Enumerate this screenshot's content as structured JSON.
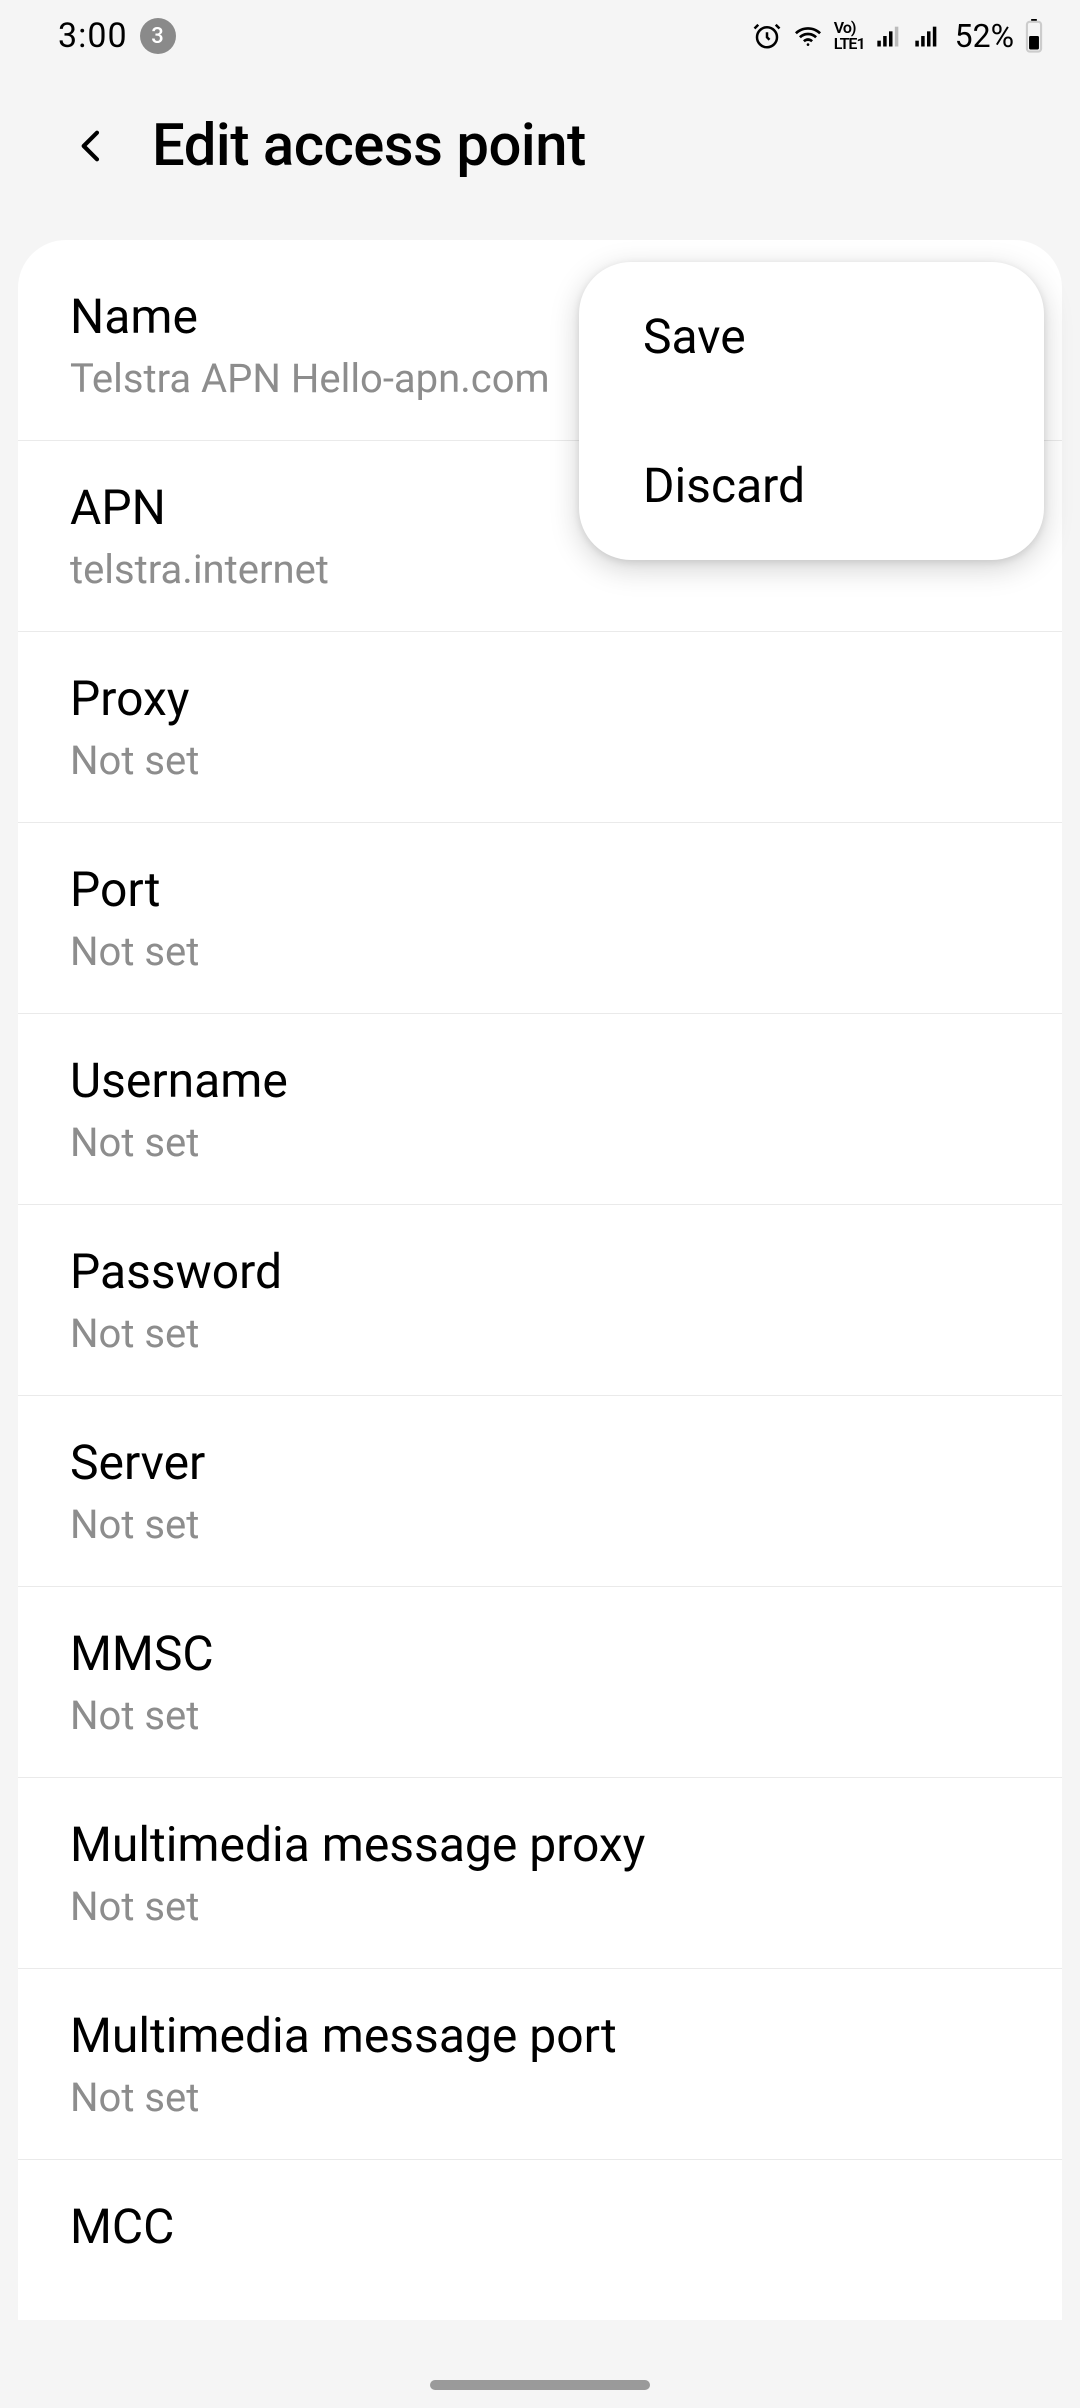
{
  "status": {
    "time": "3:00",
    "notif_count": "3",
    "battery_percent": "52%"
  },
  "header": {
    "title": "Edit access point"
  },
  "popup": {
    "save": "Save",
    "discard": "Discard"
  },
  "rows": [
    {
      "title": "Name",
      "value": "Telstra APN Hello-apn.com"
    },
    {
      "title": "APN",
      "value": "telstra.internet"
    },
    {
      "title": "Proxy",
      "value": "Not set"
    },
    {
      "title": "Port",
      "value": "Not set"
    },
    {
      "title": "Username",
      "value": "Not set"
    },
    {
      "title": "Password",
      "value": "Not set"
    },
    {
      "title": "Server",
      "value": "Not set"
    },
    {
      "title": "MMSC",
      "value": "Not set"
    },
    {
      "title": "Multimedia message proxy",
      "value": "Not set"
    },
    {
      "title": "Multimedia message port",
      "value": "Not set"
    },
    {
      "title": "MCC",
      "value": ""
    }
  ]
}
